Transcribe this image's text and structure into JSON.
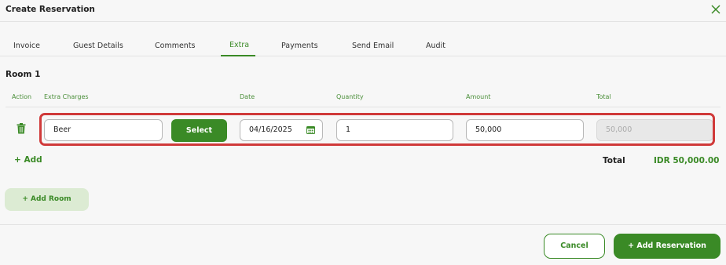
{
  "dialog": {
    "title": "Create Reservation",
    "close_icon": "close-icon"
  },
  "tabs": [
    {
      "label": "Invoice",
      "active": false
    },
    {
      "label": "Guest Details",
      "active": false
    },
    {
      "label": "Comments",
      "active": false
    },
    {
      "label": "Extra",
      "active": true
    },
    {
      "label": "Payments",
      "active": false
    },
    {
      "label": "Send Email",
      "active": false
    },
    {
      "label": "Audit",
      "active": false
    }
  ],
  "room": {
    "title": "Room 1",
    "columns": {
      "action": "Action",
      "extra_charges": "Extra Charges",
      "date": "Date",
      "quantity": "Quantity",
      "amount": "Amount",
      "total": "Total"
    },
    "row": {
      "extra_charge": "Beer",
      "select_label": "Select",
      "date": "04/16/2025",
      "quantity": "1",
      "amount": "50,000",
      "total": "50,000"
    },
    "add_label": "+ Add",
    "total_label": "Total",
    "total_value": "IDR 50,000.00"
  },
  "actions": {
    "add_room": "+ Add Room",
    "cancel": "Cancel",
    "add_reservation": "+ Add Reservation"
  },
  "colors": {
    "brand_green": "#3a8a26",
    "light_green": "#dcebd3",
    "highlight_red": "#d03a3a"
  }
}
